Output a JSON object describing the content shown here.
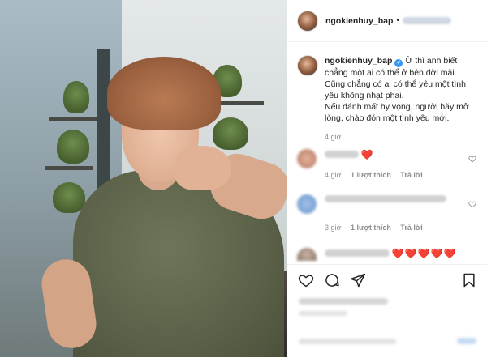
{
  "post": {
    "username": "ngokienhuy_bap",
    "verified_badge": "✓",
    "dot": "•",
    "caption_lines": [
      "Ừ thì anh biết",
      "chẳng một ai có thể ở bên đời mãi.",
      "Cũng chẳng có ai có thể yêu một tình",
      "yêu không nhạt phai.",
      "Nếu đánh mất hy vọng, người hãy mở",
      "lòng, chào đón một tình yêu mới."
    ],
    "caption_time": "4 giờ"
  },
  "comments": [
    {
      "text": "❤️",
      "time": "4 giờ",
      "likes": "1 lượt thích",
      "reply": "Trả lời"
    },
    {
      "text": "",
      "time": "3 giờ",
      "likes": "1 lượt thích",
      "reply": "Trả lời"
    },
    {
      "text": "❤️❤️❤️❤️❤️"
    }
  ],
  "icons": {
    "like": "heart-icon",
    "comment": "comment-icon",
    "share": "share-icon",
    "save": "bookmark-icon"
  },
  "colors": {
    "verified": "#3897f0",
    "heart": "#e0245e",
    "muted": "#8e8e8e"
  }
}
